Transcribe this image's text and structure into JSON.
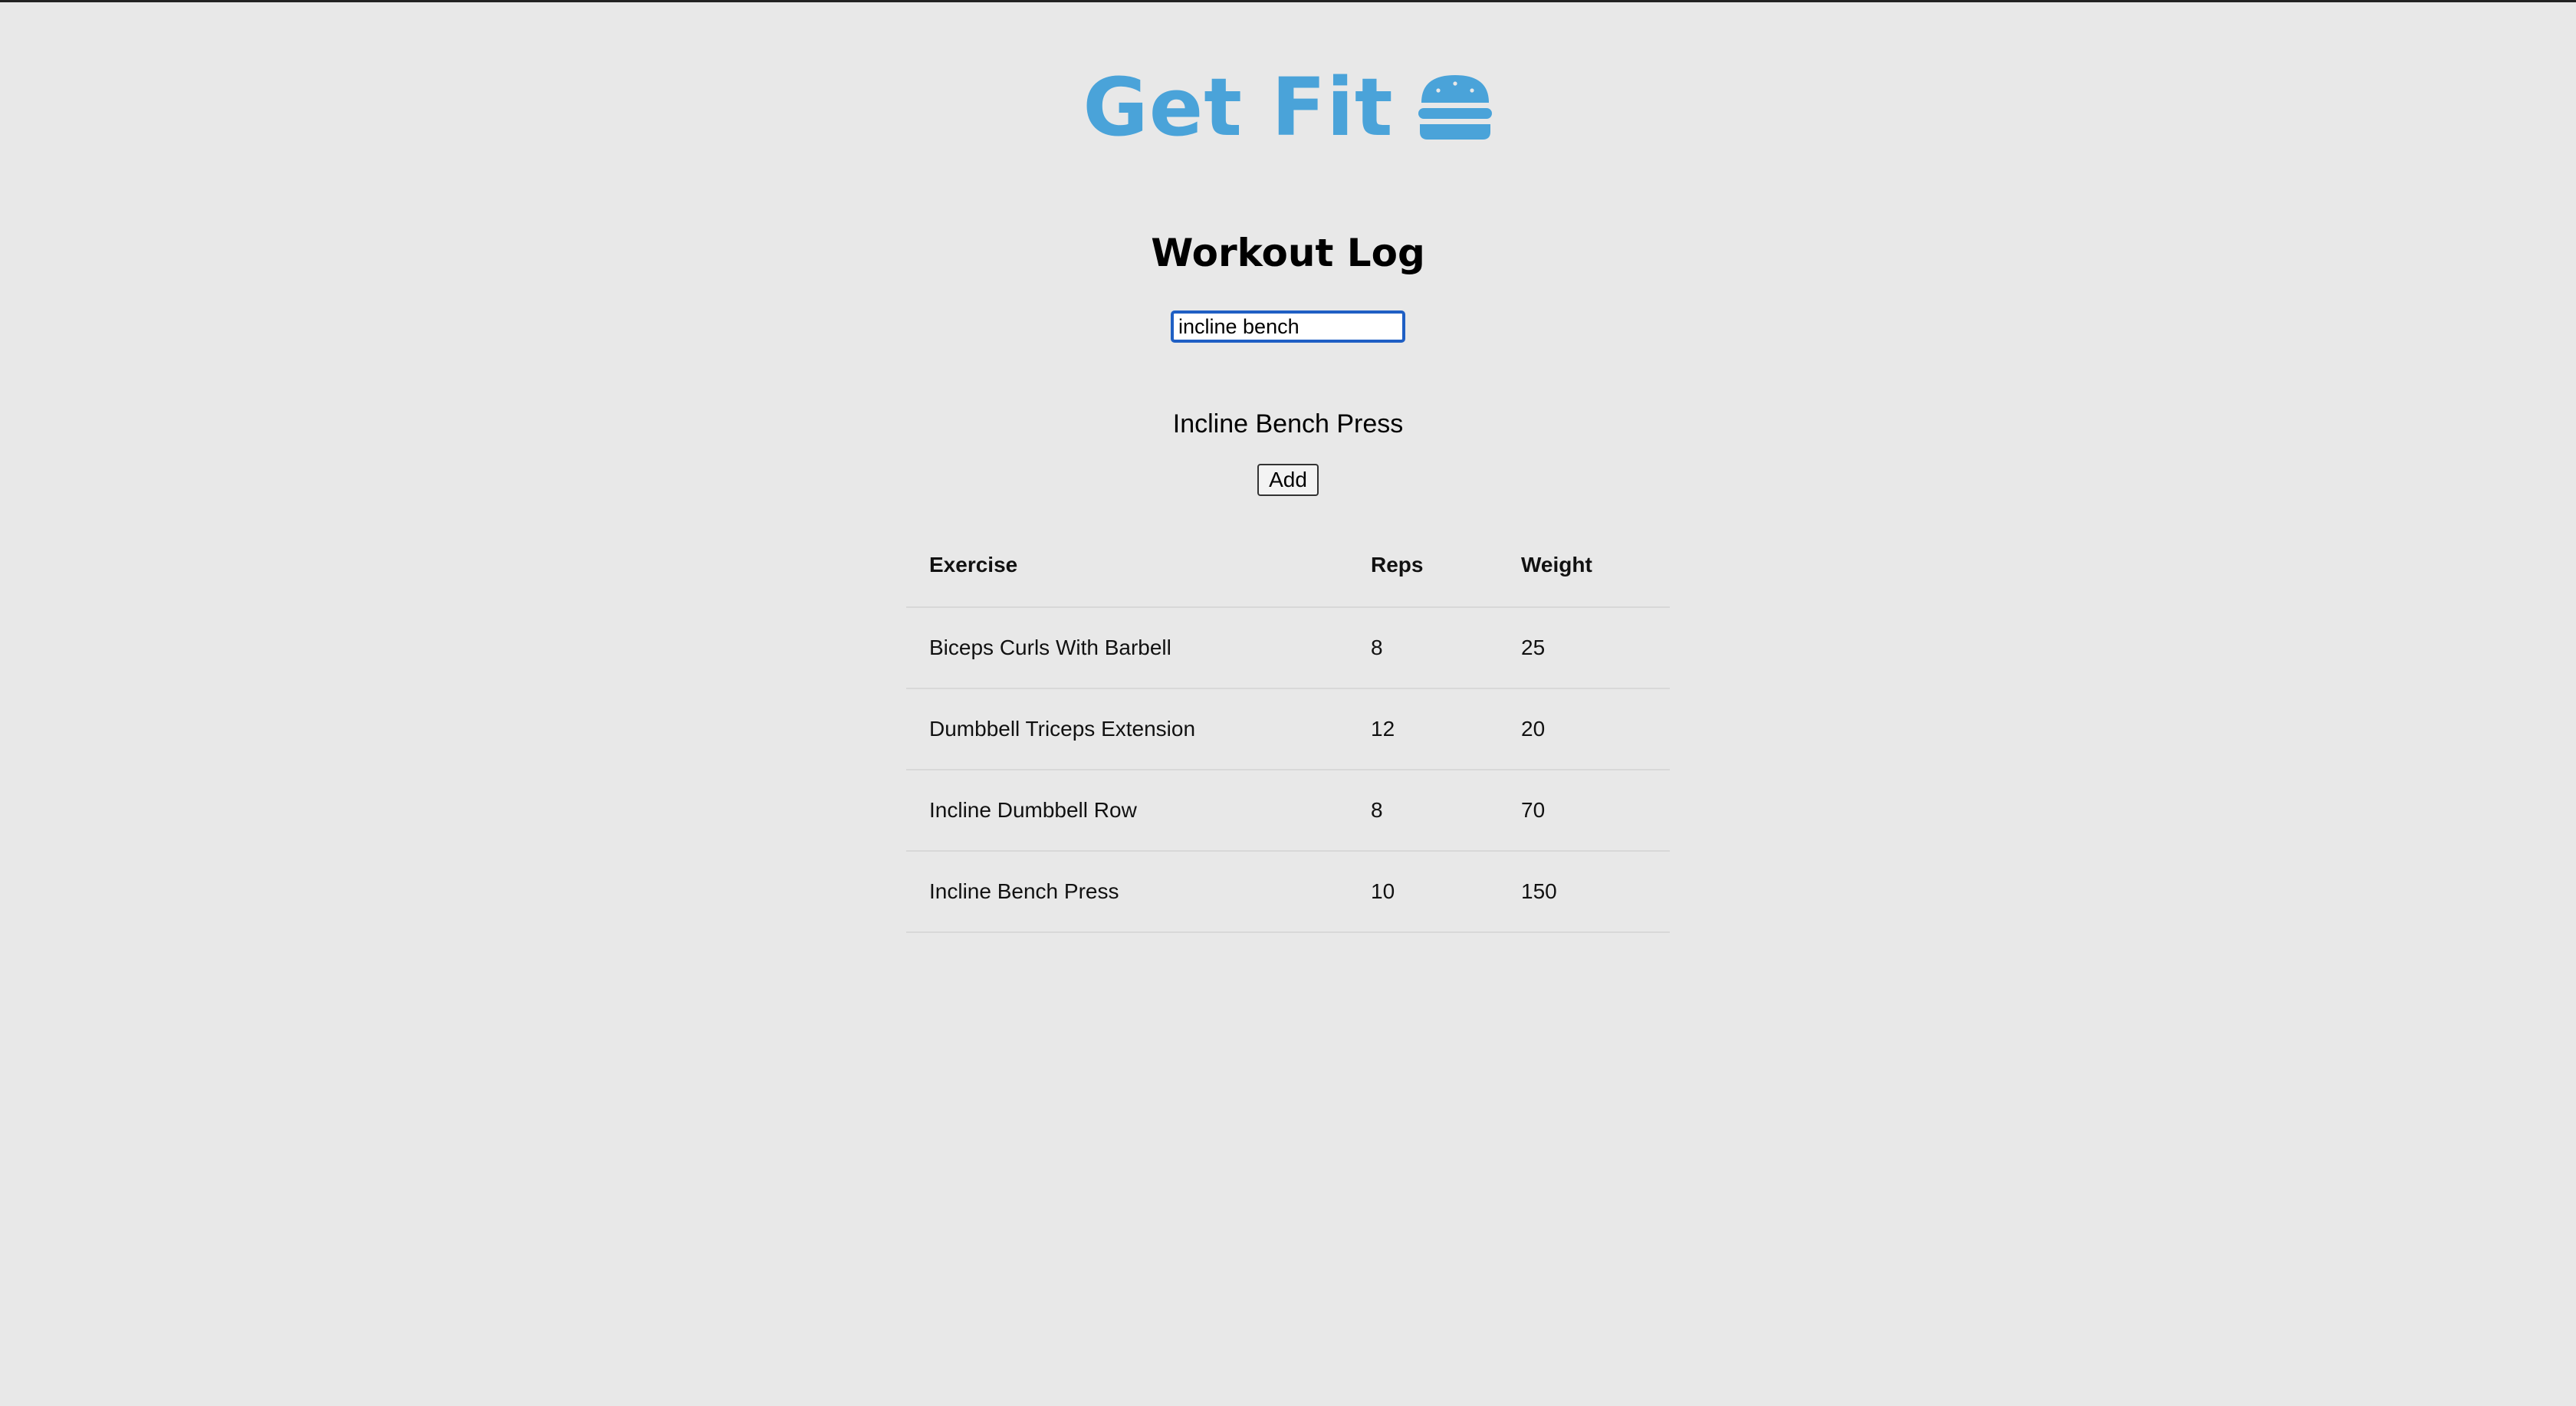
{
  "app": {
    "title": "Get Fit",
    "brand_color": "#4aa3d9",
    "logo_icon": "hamburger-icon"
  },
  "page": {
    "title": "Workout Log"
  },
  "search": {
    "value": "incline bench"
  },
  "suggestion": {
    "label": "Incline Bench Press"
  },
  "actions": {
    "add_label": "Add"
  },
  "table": {
    "headers": [
      "Exercise",
      "Reps",
      "Weight"
    ],
    "rows": [
      {
        "exercise": "Biceps Curls With Barbell",
        "reps": "8",
        "weight": "25"
      },
      {
        "exercise": "Dumbbell Triceps Extension",
        "reps": "12",
        "weight": "20"
      },
      {
        "exercise": "Incline Dumbbell Row",
        "reps": "8",
        "weight": "70"
      },
      {
        "exercise": "Incline Bench Press",
        "reps": "10",
        "weight": "150"
      }
    ]
  }
}
